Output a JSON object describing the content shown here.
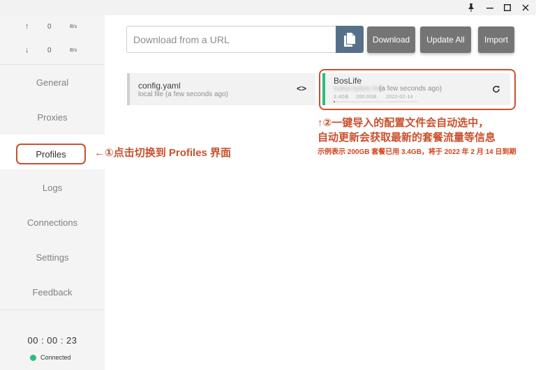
{
  "titlebar": {
    "pin_icon": "pin-icon",
    "minimize_icon": "minimize-icon",
    "maximize_icon": "maximize-icon",
    "close_icon": "close-icon"
  },
  "traffic": {
    "up": {
      "arrow": "↑",
      "value": "0",
      "unit": "B/s"
    },
    "down": {
      "arrow": "↓",
      "value": "0",
      "unit": "B/s"
    }
  },
  "sidebar": {
    "items": [
      {
        "label": "General"
      },
      {
        "label": "Proxies"
      },
      {
        "label": "Profiles"
      },
      {
        "label": "Logs"
      },
      {
        "label": "Connections"
      },
      {
        "label": "Settings"
      },
      {
        "label": "Feedback"
      }
    ],
    "active": "Profiles",
    "timer": "00 : 00 : 23",
    "status": "Connected",
    "status_color": "#2dbd7d"
  },
  "toolbar": {
    "url_placeholder": "Download from a URL",
    "paste_icon": "paste-icon",
    "download_label": "Download",
    "update_all_label": "Update All",
    "import_label": "Import"
  },
  "profiles": [
    {
      "name": "config.yaml",
      "subtitle": "local file (a few seconds ago)",
      "action_icon": "code-icon",
      "action_glyph": "<>"
    },
    {
      "name": "BosLife",
      "subtitle_blurred": "subscription link",
      "subtitle": "(a few seconds ago)",
      "used": "3.4GB",
      "total": "200.0GB",
      "expires": "2022-02-14",
      "action_icon": "refresh-icon",
      "selected": true,
      "accent": "#2dbd7d"
    }
  ],
  "annotations": {
    "step1": "←①点击切换到 Profiles 界面",
    "step2_line1": "↑②一键导入的配置文件会自动选中，",
    "step2_line2": "自动更新会获取最新的套餐流量等信息",
    "step2_note": "示例表示 200GB 套餐已用 3.4GB，将于 2022 年 2 月 14 日到期",
    "highlight_color": "#c9502d"
  }
}
